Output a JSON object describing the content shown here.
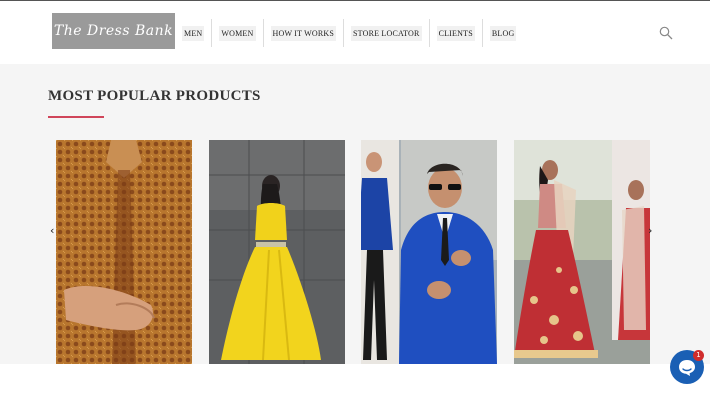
{
  "header": {
    "logo_text": "The Dress Bank",
    "nav": [
      {
        "label": "MEN"
      },
      {
        "label": "WOMEN"
      },
      {
        "label": "HOW IT WORKS"
      },
      {
        "label": "STORE LOCATOR"
      },
      {
        "label": "CLIENTS"
      },
      {
        "label": "BLOG"
      }
    ],
    "search_icon": "search-icon"
  },
  "popular": {
    "title": "MOST POPULAR PRODUCTS",
    "accent_color": "#d0455a",
    "prev_icon": "chevron-left-icon",
    "next_icon": "chevron-right-icon",
    "prev_glyph": "‹",
    "next_glyph": "›",
    "products": [
      {
        "image": "man-in-embroidered-sherwani"
      },
      {
        "image": "woman-in-yellow-gown"
      },
      {
        "image": "man-in-blue-suit"
      },
      {
        "image": "woman-in-red-lehenga"
      }
    ]
  },
  "chat": {
    "icon": "chat-icon",
    "badge_count": "1",
    "color": "#1a5fb4"
  }
}
